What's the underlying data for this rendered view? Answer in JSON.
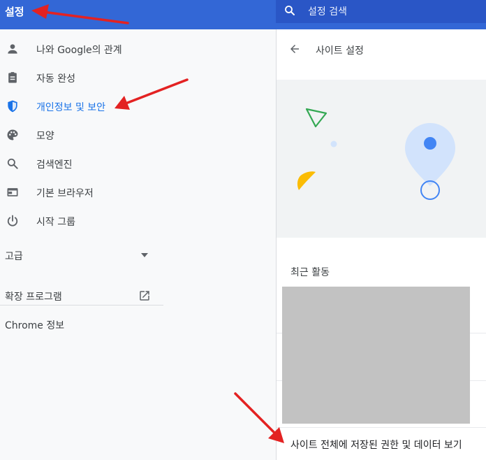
{
  "header": {
    "title": "설정",
    "search_placeholder": "설정 검색"
  },
  "sidebar": {
    "items": [
      {
        "label": "나와 Google의 관계",
        "icon": "person-icon"
      },
      {
        "label": "자동 완성",
        "icon": "clipboard-icon"
      },
      {
        "label": "개인정보 및 보안",
        "icon": "shield-icon",
        "active": true
      },
      {
        "label": "모양",
        "icon": "palette-icon"
      },
      {
        "label": "검색엔진",
        "icon": "search-icon"
      },
      {
        "label": "기본 브라우저",
        "icon": "browser-icon"
      },
      {
        "label": "시작 그룹",
        "icon": "power-icon"
      }
    ],
    "advanced_label": "고급",
    "extensions_label": "확장 프로그램",
    "about_label": "Chrome 정보"
  },
  "main": {
    "page_title": "사이트 설정",
    "section_title": "최근 활동",
    "footer_link": "사이트 전체에 저장된 권한 및 데이터 보기"
  },
  "colors": {
    "header": "#3367d6",
    "accent": "#1a73e8",
    "annotation": "#e32222"
  }
}
